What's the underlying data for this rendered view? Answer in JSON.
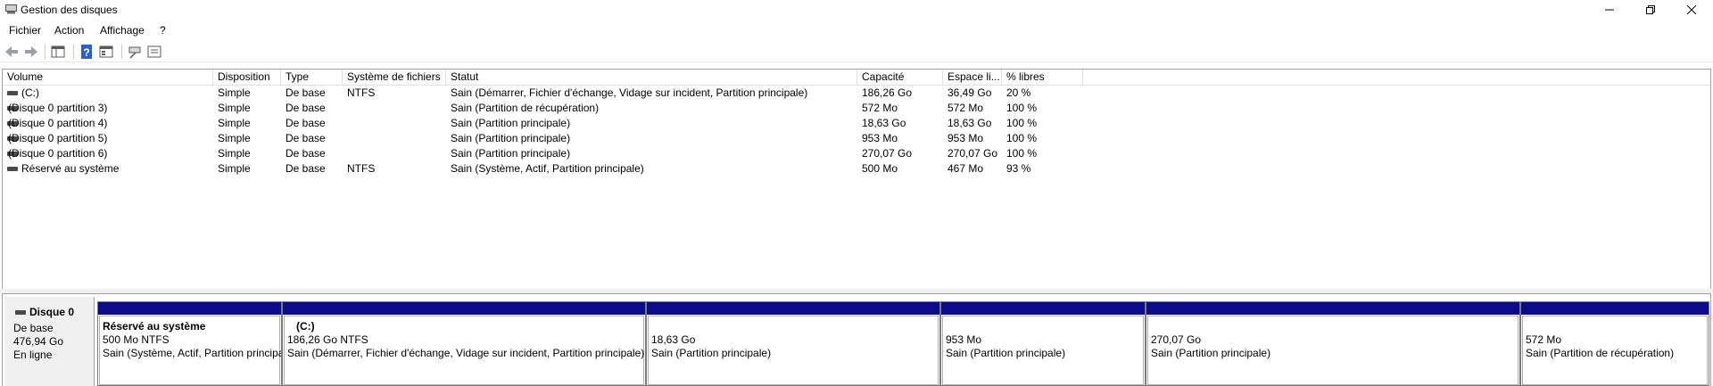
{
  "window": {
    "title": "Gestion des disques"
  },
  "menu": [
    "Fichier",
    "Action",
    "Affichage",
    "?"
  ],
  "toolbar": [
    "back-icon",
    "forward-icon",
    "console-tree-icon",
    "help-icon",
    "properties-icon",
    "connect-icon",
    "details-icon"
  ],
  "columns": [
    "Volume",
    "Disposition",
    "Type",
    "Système de fichiers",
    "Statut",
    "Capacité",
    "Espace li...",
    "% libres"
  ],
  "volumes": [
    {
      "volume": "(C:)",
      "disposition": "Simple",
      "type": "De base",
      "fs": "NTFS",
      "statut": "Sain (Démarrer, Fichier d'échange, Vidage sur incident, Partition principale)",
      "capacite": "186,26 Go",
      "libre": "36,49 Go",
      "pct": "20 %"
    },
    {
      "volume": "(Disque 0 partition 3)",
      "disposition": "Simple",
      "type": "De base",
      "fs": "",
      "statut": "Sain (Partition de récupération)",
      "capacite": "572 Mo",
      "libre": "572 Mo",
      "pct": "100 %"
    },
    {
      "volume": "(Disque 0 partition 4)",
      "disposition": "Simple",
      "type": "De base",
      "fs": "",
      "statut": "Sain (Partition principale)",
      "capacite": "18,63 Go",
      "libre": "18,63 Go",
      "pct": "100 %"
    },
    {
      "volume": "(Disque 0 partition 5)",
      "disposition": "Simple",
      "type": "De base",
      "fs": "",
      "statut": "Sain (Partition principale)",
      "capacite": "953 Mo",
      "libre": "953 Mo",
      "pct": "100 %"
    },
    {
      "volume": "(Disque 0 partition 6)",
      "disposition": "Simple",
      "type": "De base",
      "fs": "",
      "statut": "Sain (Partition principale)",
      "capacite": "270,07 Go",
      "libre": "270,07 Go",
      "pct": "100 %"
    },
    {
      "volume": "Réservé au système",
      "disposition": "Simple",
      "type": "De base",
      "fs": "NTFS",
      "statut": "Sain (Système, Actif, Partition principale)",
      "capacite": "500 Mo",
      "libre": "467 Mo",
      "pct": "93 %"
    }
  ],
  "disk": {
    "name": "Disque 0",
    "type": "De base",
    "size": "476,94 Go",
    "status": "En ligne"
  },
  "partitions": [
    {
      "name": "Réservé au système",
      "size": "500 Mo NTFS",
      "status": "Sain (Système, Actif, Partition principale)"
    },
    {
      "name": "(C:)",
      "size": "186,26 Go NTFS",
      "status": "Sain (Démarrer, Fichier d'échange, Vidage sur incident, Partition principale)"
    },
    {
      "name": "",
      "size": "18,63 Go",
      "status": "Sain (Partition principale)"
    },
    {
      "name": "",
      "size": "953 Mo",
      "status": "Sain (Partition principale)"
    },
    {
      "name": "",
      "size": "270,07 Go",
      "status": "Sain (Partition principale)"
    },
    {
      "name": "",
      "size": "572 Mo",
      "status": "Sain (Partition de récupération)"
    }
  ],
  "colors": {
    "partition_band": "#0c0c8a",
    "list_border": "#a0a0a0"
  }
}
